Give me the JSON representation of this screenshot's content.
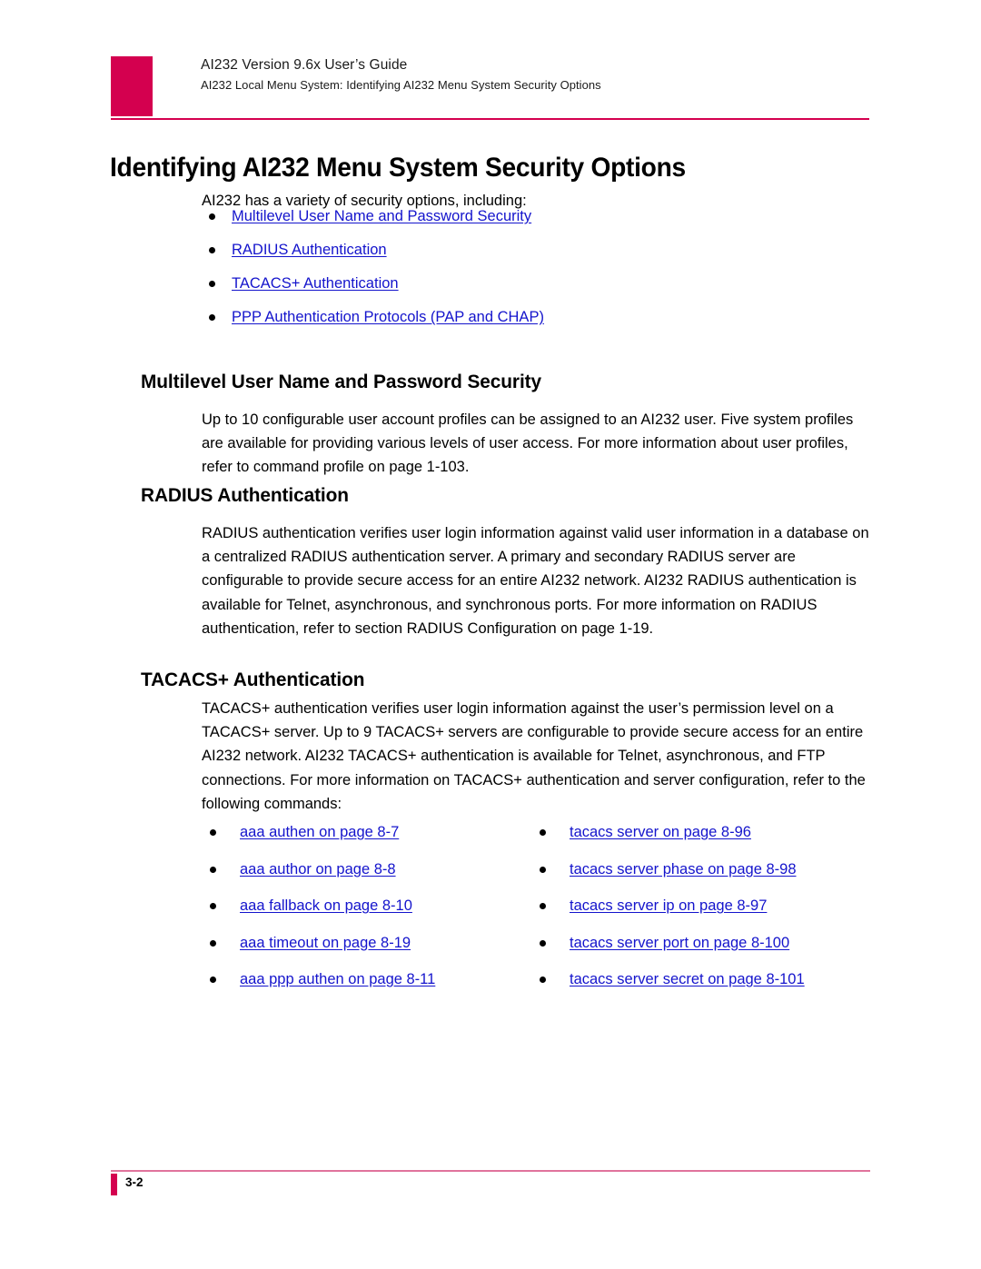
{
  "document": {
    "running_header": {
      "title": "AI232 Version 9.6x User’s Guide",
      "subtitle": "AI232 Local Menu System: Identifying AI232 Menu System Security Options"
    },
    "chapter_title": "Identifying AI232 Menu System Security Options",
    "intro_paragraph": "AI232 has a variety of security options, including:",
    "overview_links": [
      {
        "label": "Multilevel User Name and Password Security"
      },
      {
        "label": "RADIUS Authentication"
      },
      {
        "label": "TACACS+ Authentication"
      },
      {
        "label": "PPP Authentication Protocols (PAP and CHAP)"
      }
    ],
    "sections": [
      {
        "heading": "Multilevel User Name and Password Security",
        "body": "Up to 10 configurable user account profiles can be assigned to an AI232 user. Five system profiles are available for providing various levels of user access. For more information about user profiles, refer to command profile on page 1-103."
      },
      {
        "heading": "RADIUS Authentication",
        "body": "RADIUS authentication verifies user login information against valid user information in a database on a centralized RADIUS authentication server. A primary and secondary RADIUS server are configurable to provide secure access for an entire AI232 network. AI232 RADIUS authentication is available for Telnet, asynchronous, and synchronous ports. For more information on RADIUS authentication, refer to section RADIUS Configuration on page 1-19."
      },
      {
        "heading": "TACACS+ Authentication",
        "body": "TACACS+ authentication verifies user login information against the user’s permission level on a TACACS+ server. Up to 9 TACACS+ servers are configurable to provide secure access for an entire AI232 network. AI232 TACACS+ authentication is available for Telnet, asynchronous, and FTP connections. For more information on TACACS+ authentication and server configuration, refer to the following commands:"
      }
    ],
    "command_links": {
      "left_column": [
        {
          "label": "aaa authen on page 8-7"
        },
        {
          "label": "aaa author on page 8-8"
        },
        {
          "label": "aaa fallback on page 8-10"
        },
        {
          "label": "aaa timeout on page 8-19"
        },
        {
          "label": "aaa ppp authen on page 8-11"
        }
      ],
      "right_column": [
        {
          "label": "tacacs server on page 8-96"
        },
        {
          "label": "tacacs server phase on page 8-98"
        },
        {
          "label": "tacacs server ip on page 8-97"
        },
        {
          "label": "tacacs server port on page 8-100"
        },
        {
          "label": "tacacs server secret on page 8-101"
        }
      ]
    },
    "footer": {
      "page_number": "3-2"
    },
    "colors": {
      "accent_magenta": "#D4004F",
      "footer_rule": "#E0739C",
      "link_blue": "#1414CC",
      "text_black": "#000000"
    }
  }
}
